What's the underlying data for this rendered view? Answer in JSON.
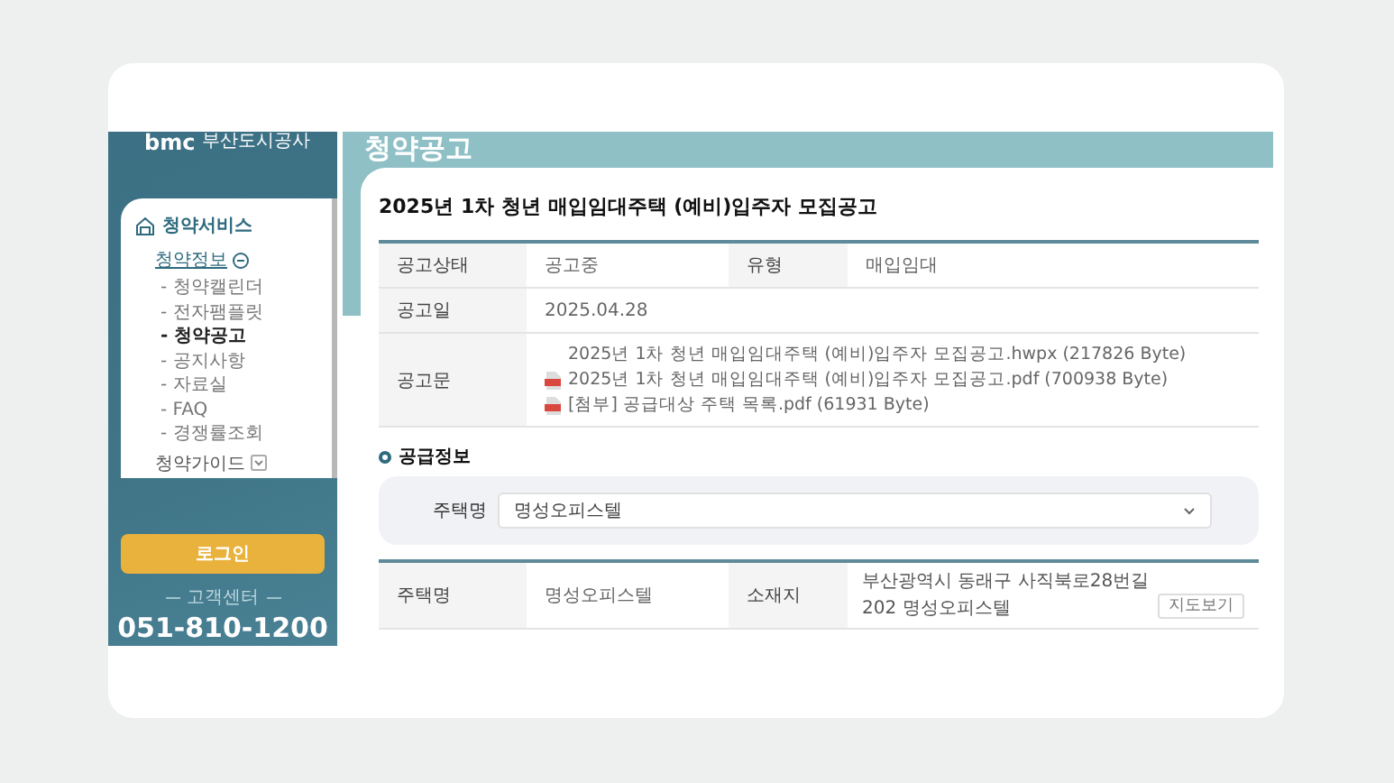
{
  "logo": {
    "mark": "bmc",
    "name": "부산도시공사"
  },
  "sidebar": {
    "section": "청약서비스",
    "groups": [
      {
        "label": "청약정보",
        "expanded": true,
        "items": [
          {
            "label": "- 청약캘린더",
            "selected": false
          },
          {
            "label": "- 전자팸플릿",
            "selected": false
          },
          {
            "label": "- 청약공고",
            "selected": true
          },
          {
            "label": "- 공지사항",
            "selected": false
          },
          {
            "label": "- 자료실",
            "selected": false
          },
          {
            "label": "- FAQ",
            "selected": false
          },
          {
            "label": "- 경쟁률조회",
            "selected": false
          }
        ]
      },
      {
        "label": "청약가이드",
        "expanded": false
      }
    ]
  },
  "login_button": "로그인",
  "support": {
    "label": "고객센터",
    "phone": "051-810-1200"
  },
  "page_title": "청약공고",
  "notice": {
    "title": "2025년 1차 청년 매입임대주택 (예비)입주자 모집공고",
    "rows": [
      {
        "cells": [
          {
            "kind": "label",
            "text": "공고상태"
          },
          {
            "kind": "value",
            "text": "공고중"
          },
          {
            "kind": "label",
            "text": "유형"
          },
          {
            "kind": "value",
            "text": "매입임대"
          }
        ]
      },
      {
        "cells": [
          {
            "kind": "label",
            "text": "공고일"
          },
          {
            "kind": "wide",
            "text": "2025.04.28"
          }
        ]
      },
      {
        "cells": [
          {
            "kind": "label",
            "text": "공고문"
          },
          {
            "kind": "files",
            "files": [
              {
                "kind": "plain",
                "name": "2025년 1차 청년 매입임대주택 (예비)입주자 모집공고.hwpx (217826 Byte)"
              },
              {
                "kind": "pdf",
                "name": "2025년 1차 청년 매입임대주택 (예비)입주자 모집공고.pdf (700938 Byte)"
              },
              {
                "kind": "pdf",
                "name": "[첨부] 공급대상 주택 목록.pdf (61931 Byte)"
              }
            ]
          }
        ]
      }
    ]
  },
  "supply": {
    "heading": "공급정보",
    "filter": {
      "label": "주택명",
      "value": "명성오피스텔"
    },
    "rows": [
      {
        "cells": [
          {
            "kind": "label",
            "text": "주택명"
          },
          {
            "kind": "value",
            "text": "명성오피스텔"
          },
          {
            "kind": "label",
            "text": "소재지"
          },
          {
            "kind": "address",
            "text": "부산광역시 동래구 사직북로28번길 202 명성오피스텔",
            "button": "지도보기"
          }
        ]
      }
    ]
  }
}
